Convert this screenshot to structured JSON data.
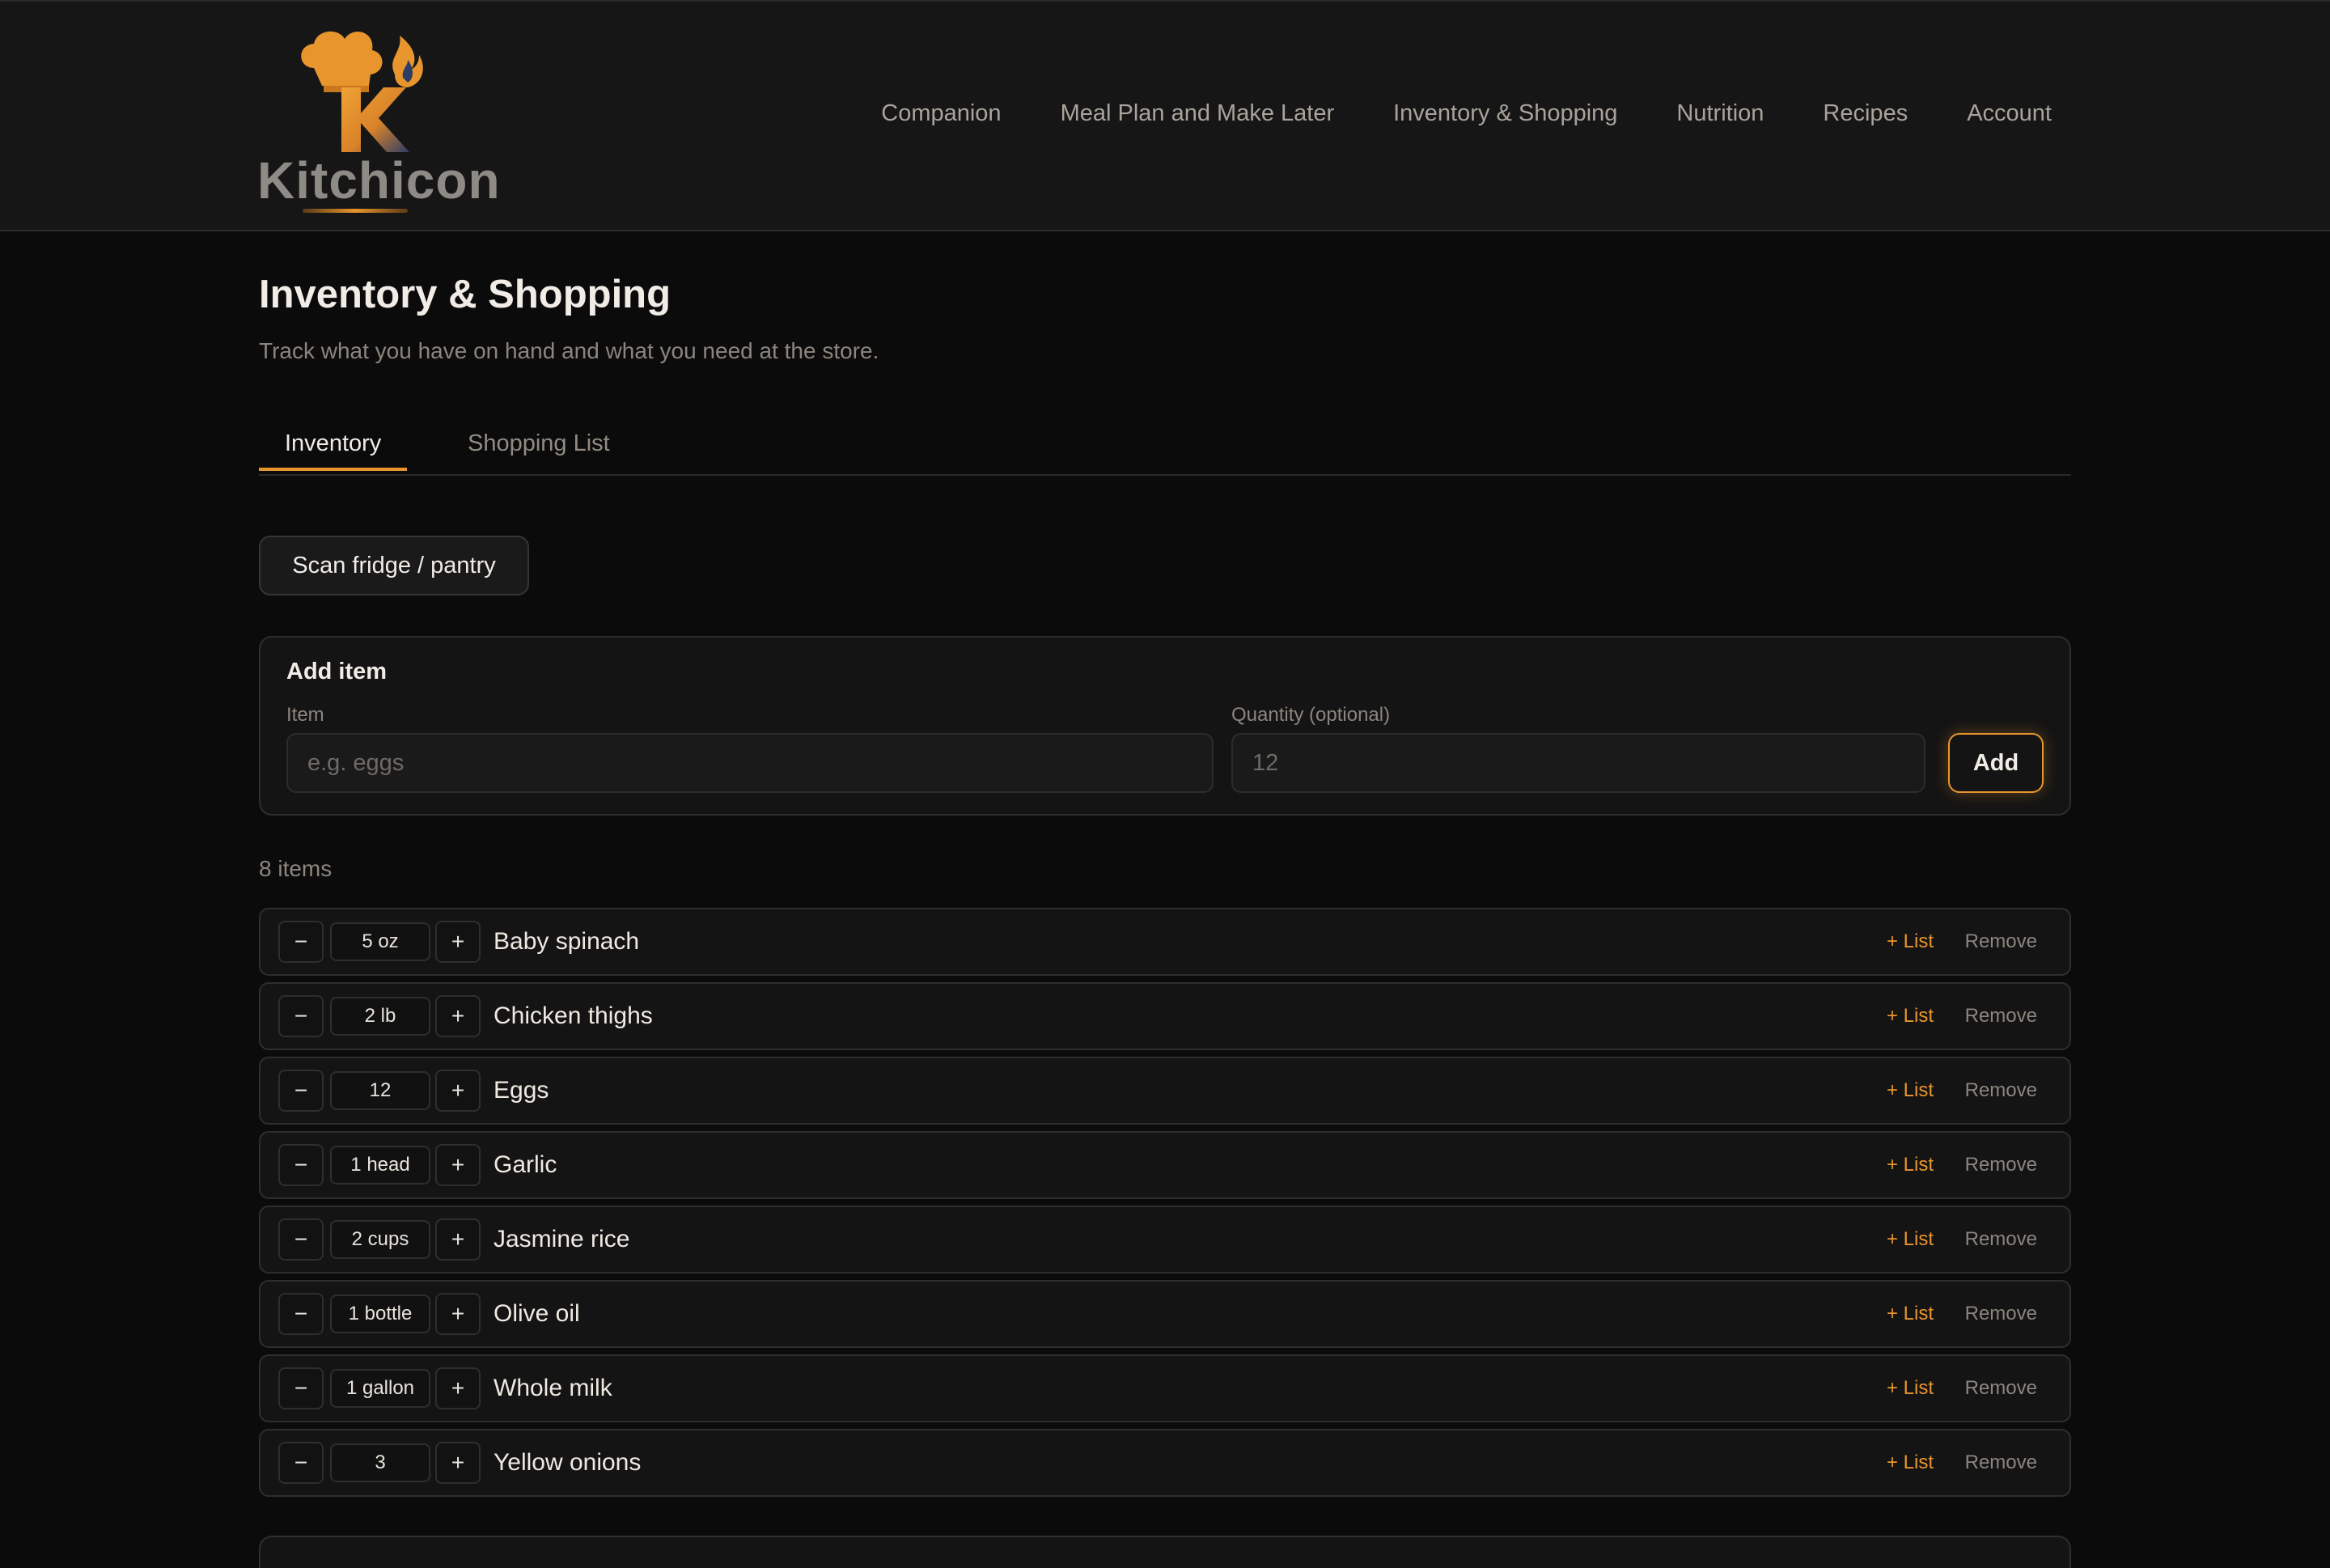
{
  "brand": {
    "name": "Kitchicon"
  },
  "nav": [
    "Companion",
    "Meal Plan and Make Later",
    "Inventory & Shopping",
    "Nutrition",
    "Recipes",
    "Account"
  ],
  "page": {
    "title": "Inventory & Shopping",
    "subtitle": "Track what you have on hand and what you need at the store."
  },
  "tabs": [
    {
      "label": "Inventory",
      "active": true
    },
    {
      "label": "Shopping List",
      "active": false
    }
  ],
  "scan_button": "Scan fridge / pantry",
  "add_form": {
    "title": "Add item",
    "item_label": "Item",
    "item_placeholder": "e.g. eggs",
    "qty_label": "Quantity (optional)",
    "qty_placeholder": "12",
    "add_button": "Add"
  },
  "count_text": "8 items",
  "row_labels": {
    "minus": "−",
    "plus": "+",
    "add_to_list": "+ List",
    "remove": "Remove"
  },
  "items": [
    {
      "qty": "5 oz",
      "name": "Baby spinach"
    },
    {
      "qty": "2 lb",
      "name": "Chicken thighs"
    },
    {
      "qty": "12",
      "name": "Eggs"
    },
    {
      "qty": "1 head",
      "name": "Garlic"
    },
    {
      "qty": "2 cups",
      "name": "Jasmine rice"
    },
    {
      "qty": "1 bottle",
      "name": "Olive oil"
    },
    {
      "qty": "1 gallon",
      "name": "Whole milk"
    },
    {
      "qty": "3",
      "name": "Yellow onions"
    }
  ],
  "colors": {
    "accent": "#e8952e",
    "background": "#0b0b0b",
    "card": "#141414"
  },
  "icons": {
    "logo": "chef-hat-k-icon"
  }
}
